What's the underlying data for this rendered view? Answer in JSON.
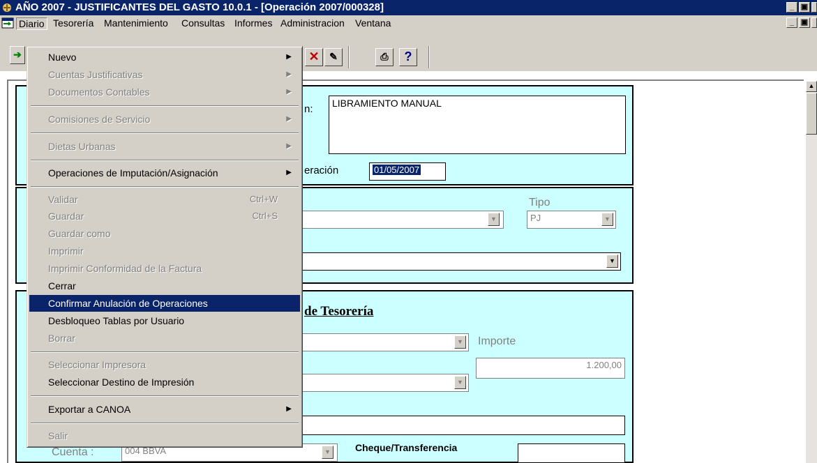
{
  "window": {
    "title": "AÑO 2007 - JUSTIFICANTES DEL GASTO 10.0.1 - [Operación 2007/000328]",
    "controls": [
      "_",
      "🗗",
      "✕"
    ]
  },
  "menubar": {
    "items": [
      "Diario",
      "Tesorería",
      "Mantenimiento",
      "Consultas",
      "Informes",
      "Administracion",
      "Ventana"
    ],
    "mdi_controls": [
      "_",
      "🗗",
      "✕"
    ]
  },
  "toolbar": {
    "buttons": [
      "delete-icon",
      "edit-icon",
      "print-icon",
      "help-icon"
    ],
    "help_label": "?",
    "delete_label": "✕"
  },
  "form": {
    "descripcion_label_partial": "n:",
    "descripcion_value": "LIBRAMIENTO MANUAL",
    "fecha_label_partial": "eración",
    "fecha_value": "01/05/2007",
    "tipo_label": "Tipo",
    "tipo_value": "PJ",
    "tesoreria_heading_partial": "de Tesorería",
    "importe_label": "Importe",
    "importe_value": "1.200,00",
    "cuenta_label": "Cuenta :",
    "cuenta_value": "004 BBVA",
    "cheque_label": "Cheque/Transferencia"
  },
  "menu": {
    "items": [
      {
        "label": "Nuevo",
        "disabled": false,
        "submenu": true
      },
      {
        "label": "Cuentas Justificativas",
        "disabled": true,
        "submenu": true
      },
      {
        "label": "Documentos Contables",
        "disabled": true,
        "submenu": true
      },
      {
        "label": "Comisiones de Servicio",
        "disabled": true,
        "submenu": true
      },
      {
        "label": "Dietas Urbanas",
        "disabled": true,
        "submenu": true
      },
      {
        "label": "Operaciones de Imputación/Asignación",
        "disabled": false,
        "submenu": true
      },
      {
        "label": "Validar",
        "disabled": true,
        "shortcut": "Ctrl+W"
      },
      {
        "label": "Guardar",
        "disabled": true,
        "shortcut": "Ctrl+S"
      },
      {
        "label": "Guardar como",
        "disabled": true
      },
      {
        "label": "Imprimir",
        "disabled": true
      },
      {
        "label": "Imprimir Conformidad de la Factura",
        "disabled": true
      },
      {
        "label": "Cerrar",
        "disabled": false
      },
      {
        "label": "Confirmar Anulación de Operaciones",
        "disabled": false,
        "highlighted": true
      },
      {
        "label": "Desbloqueo Tablas por Usuario",
        "disabled": false
      },
      {
        "label": "Borrar",
        "disabled": true
      },
      {
        "label": "Seleccionar Impresora",
        "disabled": true
      },
      {
        "label": "Seleccionar Destino de Impresión",
        "disabled": false
      },
      {
        "label": "Exportar a CANOA",
        "disabled": false,
        "submenu": true
      },
      {
        "label": "Salir",
        "disabled": true
      }
    ]
  },
  "colors": {
    "titlebar": "#0a246a",
    "panel": "#ccffff",
    "highlight": "#0a246a",
    "chrome": "#d4d0c8"
  }
}
